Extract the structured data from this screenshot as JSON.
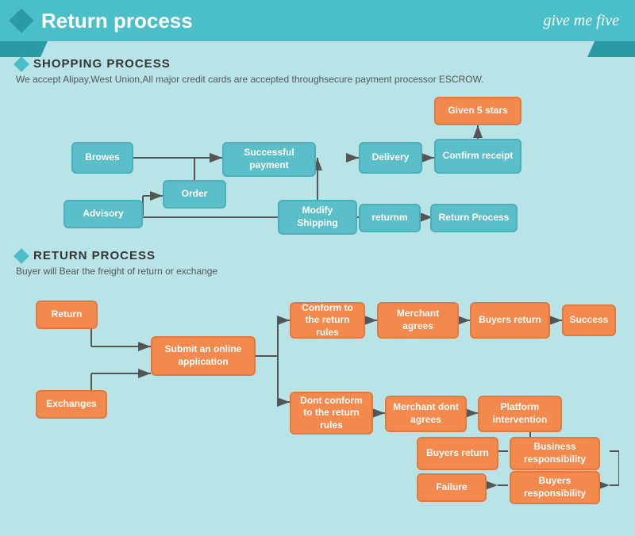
{
  "header": {
    "title": "Return process",
    "brand": "give me five"
  },
  "shopping": {
    "section_title": "SHOPPING PROCESS",
    "subtitle": "We accept Alipay,West Union,All major credit cards are accepted throughsecure payment processor ESCROW.",
    "boxes": [
      {
        "id": "browes",
        "label": "Browes",
        "type": "teal"
      },
      {
        "id": "order",
        "label": "Order",
        "type": "teal"
      },
      {
        "id": "advisory",
        "label": "Advisory",
        "type": "teal"
      },
      {
        "id": "successful_payment",
        "label": "Successful payment",
        "type": "teal"
      },
      {
        "id": "modify_shipping",
        "label": "Modify Shipping",
        "type": "teal"
      },
      {
        "id": "delivery",
        "label": "Delivery",
        "type": "teal"
      },
      {
        "id": "confirm_receipt",
        "label": "Confirm receipt",
        "type": "teal"
      },
      {
        "id": "given_5_stars",
        "label": "Given 5 stars",
        "type": "orange"
      },
      {
        "id": "returnm",
        "label": "returnm",
        "type": "teal"
      },
      {
        "id": "return_process",
        "label": "Return Process",
        "type": "teal"
      }
    ]
  },
  "return_process": {
    "section_title": "RETURN PROCESS",
    "subtitle": "Buyer will Bear the freight of return or exchange",
    "boxes": [
      {
        "id": "return_btn",
        "label": "Return",
        "type": "orange"
      },
      {
        "id": "submit_online",
        "label": "Submit an online application",
        "type": "orange"
      },
      {
        "id": "exchanges",
        "label": "Exchanges",
        "type": "orange"
      },
      {
        "id": "conform_rules",
        "label": "Conform to the return rules",
        "type": "orange"
      },
      {
        "id": "dont_conform",
        "label": "Dont conform to the return rules",
        "type": "orange"
      },
      {
        "id": "merchant_agrees",
        "label": "Merchant agrees",
        "type": "orange"
      },
      {
        "id": "merchant_dont",
        "label": "Merchant dont agrees",
        "type": "orange"
      },
      {
        "id": "buyers_return1",
        "label": "Buyers return",
        "type": "orange"
      },
      {
        "id": "platform_intervention",
        "label": "Platform intervention",
        "type": "orange"
      },
      {
        "id": "success",
        "label": "Success",
        "type": "orange"
      },
      {
        "id": "buyers_return2",
        "label": "Buyers return",
        "type": "orange"
      },
      {
        "id": "business_responsibility",
        "label": "Business responsibility",
        "type": "orange"
      },
      {
        "id": "failure",
        "label": "Failure",
        "type": "orange"
      },
      {
        "id": "buyers_responsibility",
        "label": "Buyers responsibility",
        "type": "orange"
      }
    ]
  }
}
